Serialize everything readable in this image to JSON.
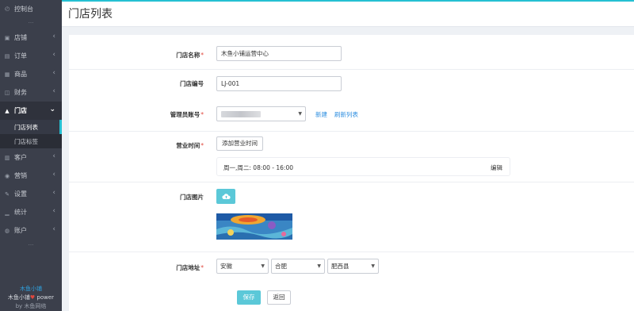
{
  "sidebar": {
    "dashboard": "控制台",
    "items": [
      {
        "label": "店铺",
        "icon": "store-icon"
      },
      {
        "label": "订单",
        "icon": "order-icon"
      },
      {
        "label": "商品",
        "icon": "goods-icon"
      },
      {
        "label": "财务",
        "icon": "finance-icon"
      },
      {
        "label": "门店",
        "icon": "shop-icon"
      }
    ],
    "sub": [
      "门店列表",
      "门店标签"
    ],
    "items2": [
      {
        "label": "客户",
        "icon": "customer-icon"
      },
      {
        "label": "营销",
        "icon": "marketing-icon"
      },
      {
        "label": "设置",
        "icon": "settings-icon"
      },
      {
        "label": "统计",
        "icon": "stats-icon"
      },
      {
        "label": "账户",
        "icon": "account-icon"
      }
    ],
    "dots": "...",
    "footer_brand": "木鱼小铺",
    "footer_power_pre": "木鱼小铺",
    "footer_power_post": " power",
    "footer_by": "by 木鱼网络"
  },
  "header": {
    "title": "门店列表"
  },
  "form": {
    "name_label": "门店名称",
    "name_value": "木鱼小铺运营中心",
    "code_label": "门店编号",
    "code_value": "LJ-001",
    "admin_label": "管理员账号",
    "admin_new": "新建",
    "admin_refresh": "刷新列表",
    "hours_label": "营业时间",
    "hours_add": "添加营业时间",
    "hours_text": "周一,周二: 08:00 - 16:00",
    "hours_edit": "编辑",
    "image_label": "门店图片",
    "address_label": "门店地址",
    "province": "安徽",
    "city": "合肥",
    "district": "肥西县",
    "required_mark": "*"
  },
  "actions": {
    "save": "保存",
    "back": "返回"
  },
  "colors": {
    "accent": "#25c0d2",
    "primary_btn": "#5bc8d8",
    "link": "#2f8fe0",
    "sidebar": "#3b3f4b"
  }
}
